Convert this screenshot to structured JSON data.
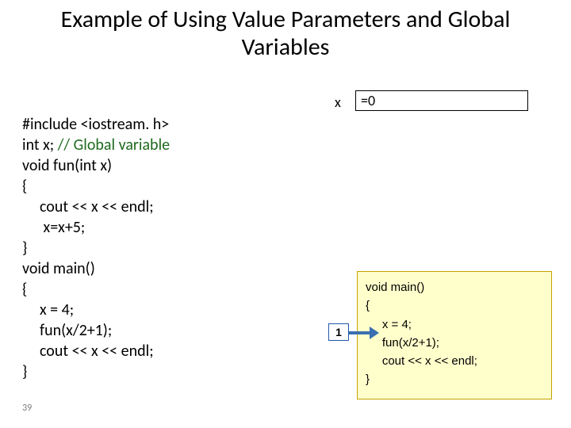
{
  "title": "Example of Using Value Parameters and Global Variables",
  "code": {
    "l1": "#include <iostream. h>",
    "l2a": "int x; ",
    "l2b": "// Global variable",
    "l3": "void fun(int x)",
    "l4": "{",
    "l5": "cout << x << endl;",
    "l6": "x=x+5;",
    "l7": "}",
    "l8": "void main()",
    "l9": "{",
    "l10": "x = 4;",
    "l11": "fun(x/2+1);",
    "l12": "cout << x << endl;",
    "l13": "}"
  },
  "page_number": "39",
  "var": {
    "label": "x",
    "value": "=0"
  },
  "step": {
    "num": "1"
  },
  "main_box": {
    "l1": "void main()",
    "l2": "{",
    "l3": "x = 4;",
    "l4": "fun(x/2+1);",
    "l5": "cout << x << endl;",
    "l6": "}"
  }
}
